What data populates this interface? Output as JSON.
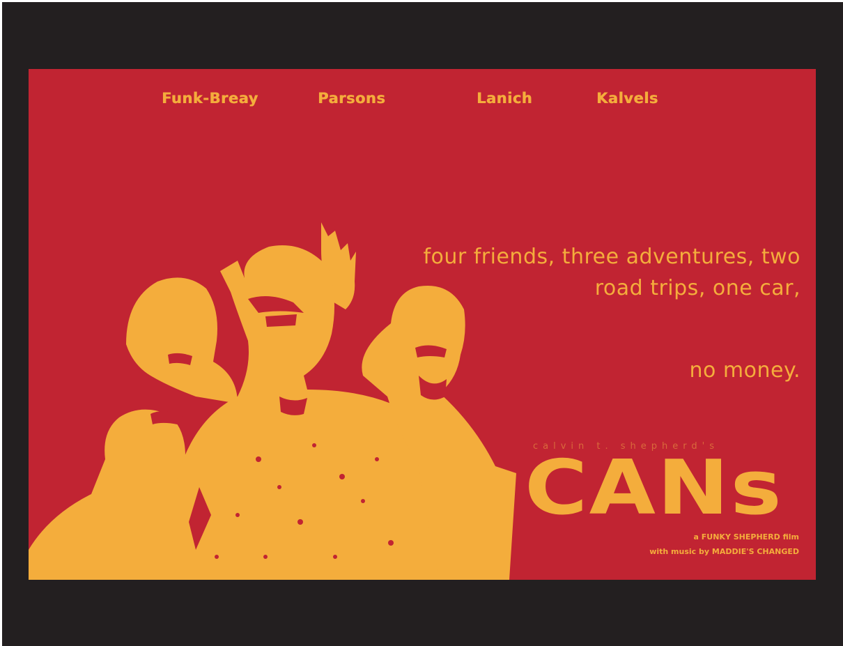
{
  "poster": {
    "cast": [
      "Funk-Breay",
      "Parsons",
      "Lanich",
      "Kalvels"
    ],
    "tagline": {
      "line1": "four friends, three adventures, two",
      "line2": "road trips, one car,",
      "line3": "no money."
    },
    "presenter": "calvin t. shepherd's",
    "title": "CANs",
    "credit_line1": "a FUNKY SHEPHERD film",
    "credit_line2": "with music by MADDIE'S CHANGED"
  },
  "colors": {
    "background": "#231f20",
    "poster_red": "#c12432",
    "poster_gold": "#f4ad3c"
  }
}
